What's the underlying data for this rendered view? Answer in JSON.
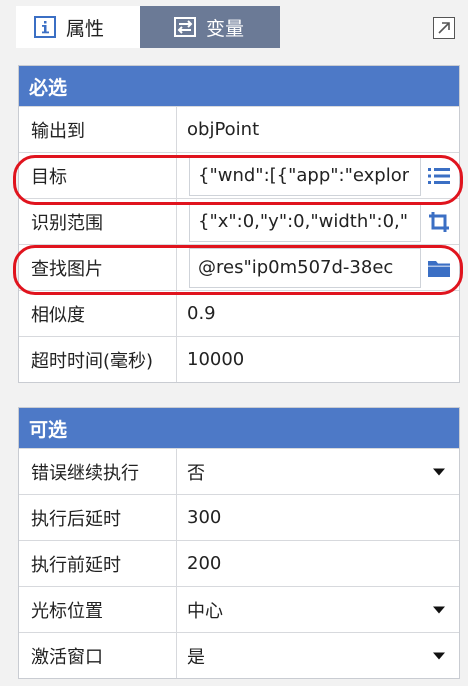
{
  "tabs": [
    {
      "label": "属性",
      "icon": "info-icon",
      "active": true
    },
    {
      "label": "变量",
      "icon": "swap-icon",
      "active": false
    }
  ],
  "colors": {
    "header": "#4d79c7",
    "tab_inactive": "#6b7a96",
    "annotation": "#e0141e"
  },
  "required": {
    "title": "必选",
    "rows": [
      {
        "label": "输出到",
        "value": "objPoint"
      },
      {
        "label": "目标",
        "value": "{\"wnd\":[{\"app\":\"explor",
        "button_icon": "list-icon"
      },
      {
        "label": "识别范围",
        "value": "{\"x\":0,\"y\":0,\"width\":0,\"",
        "button_icon": "crop-icon"
      },
      {
        "label": "查找图片",
        "value": "@res\"ip0m507d-38ec",
        "button_icon": "folder-icon"
      },
      {
        "label": "相似度",
        "value": "0.9"
      },
      {
        "label": "超时时间(毫秒)",
        "value": "10000"
      }
    ]
  },
  "optional": {
    "title": "可选",
    "rows": [
      {
        "label": "错误继续执行",
        "value": "否",
        "dropdown": true
      },
      {
        "label": "执行后延时",
        "value": "300"
      },
      {
        "label": "执行前延时",
        "value": "200"
      },
      {
        "label": "光标位置",
        "value": "中心",
        "dropdown": true
      },
      {
        "label": "激活窗口",
        "value": "是",
        "dropdown": true
      }
    ]
  }
}
